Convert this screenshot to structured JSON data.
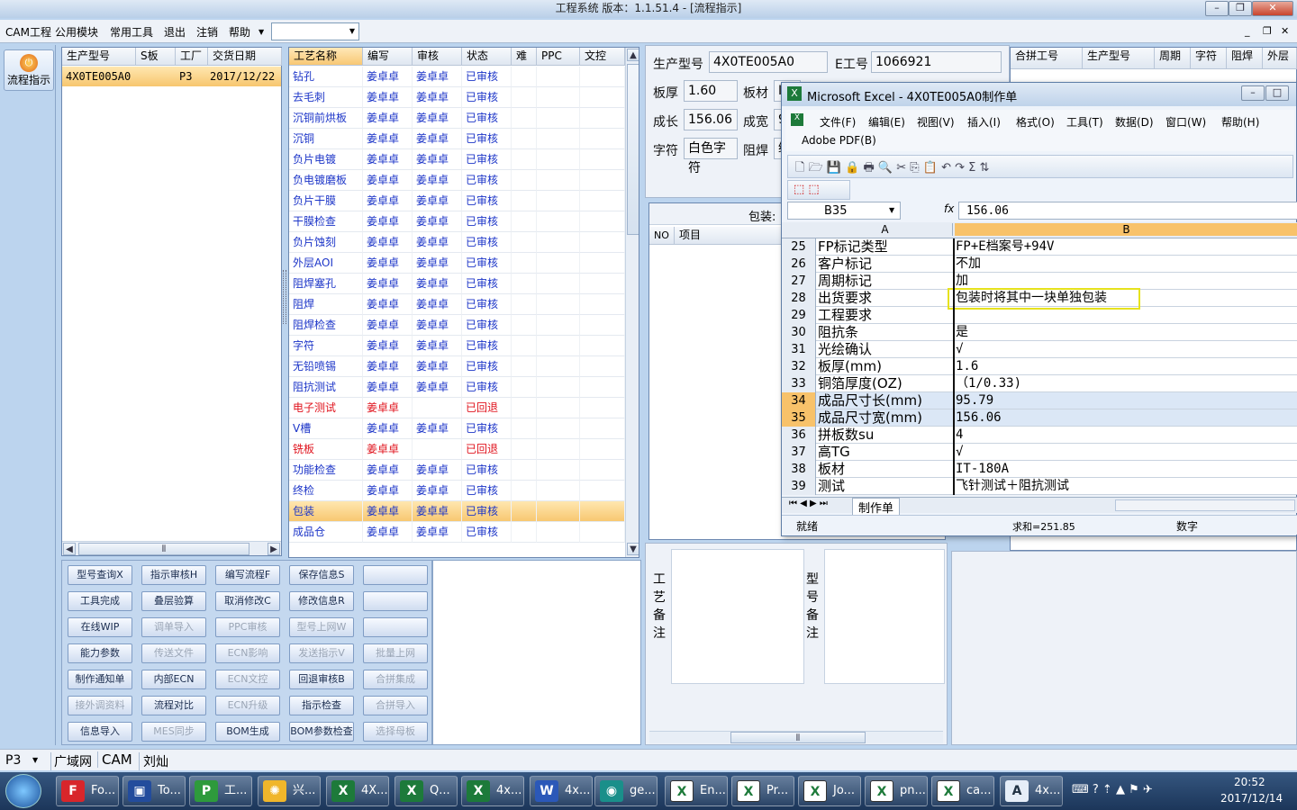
{
  "window": {
    "title": "工程系统   版本：1.1.51.4 - [流程指示]"
  },
  "menu": {
    "items": [
      "CAM工程",
      "公用模块",
      "常用工具",
      "退出",
      "注销",
      "帮助"
    ]
  },
  "sidebar": {
    "flow_label": "流程指示"
  },
  "order_table": {
    "headers": [
      "生产型号",
      "S板",
      "工厂",
      "交货日期"
    ],
    "rows": [
      {
        "model": "4X0TE005A0",
        "s": "",
        "factory": "P3",
        "date": "2017/12/22"
      }
    ]
  },
  "process_table": {
    "headers": [
      "工艺名称",
      "编写",
      "审核",
      "状态",
      "难",
      "PPC",
      "文控"
    ],
    "rows": [
      {
        "name": "钻孔",
        "writer": "姜卓卓",
        "reviewer": "姜卓卓",
        "status": "已审核"
      },
      {
        "name": "去毛刺",
        "writer": "姜卓卓",
        "reviewer": "姜卓卓",
        "status": "已审核"
      },
      {
        "name": "沉铜前烘板",
        "writer": "姜卓卓",
        "reviewer": "姜卓卓",
        "status": "已审核"
      },
      {
        "name": "沉铜",
        "writer": "姜卓卓",
        "reviewer": "姜卓卓",
        "status": "已审核"
      },
      {
        "name": "负片电镀",
        "writer": "姜卓卓",
        "reviewer": "姜卓卓",
        "status": "已审核"
      },
      {
        "name": "负电镀磨板",
        "writer": "姜卓卓",
        "reviewer": "姜卓卓",
        "status": "已审核"
      },
      {
        "name": "负片干膜",
        "writer": "姜卓卓",
        "reviewer": "姜卓卓",
        "status": "已审核"
      },
      {
        "name": "干膜检查",
        "writer": "姜卓卓",
        "reviewer": "姜卓卓",
        "status": "已审核"
      },
      {
        "name": "负片蚀刻",
        "writer": "姜卓卓",
        "reviewer": "姜卓卓",
        "status": "已审核"
      },
      {
        "name": "外层AOI",
        "writer": "姜卓卓",
        "reviewer": "姜卓卓",
        "status": "已审核"
      },
      {
        "name": "阻焊塞孔",
        "writer": "姜卓卓",
        "reviewer": "姜卓卓",
        "status": "已审核"
      },
      {
        "name": "阻焊",
        "writer": "姜卓卓",
        "reviewer": "姜卓卓",
        "status": "已审核"
      },
      {
        "name": "阻焊检查",
        "writer": "姜卓卓",
        "reviewer": "姜卓卓",
        "status": "已审核"
      },
      {
        "name": "字符",
        "writer": "姜卓卓",
        "reviewer": "姜卓卓",
        "status": "已审核"
      },
      {
        "name": "无铅喷锡",
        "writer": "姜卓卓",
        "reviewer": "姜卓卓",
        "status": "已审核"
      },
      {
        "name": "阻抗测试",
        "writer": "姜卓卓",
        "reviewer": "姜卓卓",
        "status": "已审核"
      },
      {
        "name": "电子测试",
        "writer": "姜卓卓",
        "reviewer": "",
        "status": "已回退",
        "red": true
      },
      {
        "name": "V槽",
        "writer": "姜卓卓",
        "reviewer": "姜卓卓",
        "status": "已审核"
      },
      {
        "name": "铣板",
        "writer": "姜卓卓",
        "reviewer": "",
        "status": "已回退",
        "red": true
      },
      {
        "name": "功能检查",
        "writer": "姜卓卓",
        "reviewer": "姜卓卓",
        "status": "已审核"
      },
      {
        "name": "终检",
        "writer": "姜卓卓",
        "reviewer": "姜卓卓",
        "status": "已审核"
      },
      {
        "name": "包装",
        "writer": "姜卓卓",
        "reviewer": "姜卓卓",
        "status": "已审核",
        "selected": true
      },
      {
        "name": "成品仓",
        "writer": "姜卓卓",
        "reviewer": "姜卓卓",
        "status": "已审核"
      }
    ]
  },
  "buttons": [
    [
      {
        "label": "型号查询X",
        "enabled": true
      },
      {
        "label": "指示审核H",
        "enabled": true
      },
      {
        "label": "编写流程F",
        "enabled": true
      },
      {
        "label": "保存信息S",
        "enabled": true
      },
      {
        "label": "",
        "enabled": true
      }
    ],
    [
      {
        "label": "工具完成",
        "enabled": true
      },
      {
        "label": "叠层验算",
        "enabled": true
      },
      {
        "label": "取消修改C",
        "enabled": true
      },
      {
        "label": "修改信息R",
        "enabled": true
      },
      {
        "label": "",
        "enabled": true
      }
    ],
    [
      {
        "label": "在线WIP",
        "enabled": true
      },
      {
        "label": "调单导入",
        "enabled": false
      },
      {
        "label": "PPC审核",
        "enabled": false
      },
      {
        "label": "型号上网W",
        "enabled": false
      },
      {
        "label": "",
        "enabled": true
      }
    ],
    [
      {
        "label": "能力参数",
        "enabled": true
      },
      {
        "label": "传送文件",
        "enabled": false
      },
      {
        "label": "ECN影响",
        "enabled": false
      },
      {
        "label": "发送指示V",
        "enabled": false
      },
      {
        "label": "批量上网",
        "enabled": false
      }
    ],
    [
      {
        "label": "制作通知单",
        "enabled": true
      },
      {
        "label": "内部ECN",
        "enabled": true
      },
      {
        "label": "ECN文控",
        "enabled": false
      },
      {
        "label": "回退审核B",
        "enabled": true
      },
      {
        "label": "合拼集成",
        "enabled": false
      }
    ],
    [
      {
        "label": "接外调资料",
        "enabled": false
      },
      {
        "label": "流程对比",
        "enabled": true
      },
      {
        "label": "ECN升级",
        "enabled": false
      },
      {
        "label": "指示检查",
        "enabled": true
      },
      {
        "label": "合拼导入",
        "enabled": false
      }
    ],
    [
      {
        "label": "信息导入",
        "enabled": true
      },
      {
        "label": "MES同步",
        "enabled": false
      },
      {
        "label": "BOM生成",
        "enabled": true
      },
      {
        "label": "BOM参数检查",
        "enabled": true
      },
      {
        "label": "选择母板",
        "enabled": false
      }
    ]
  ],
  "info": {
    "model_label": "生产型号",
    "model_value": "4X0TE005A0",
    "eno_label": "E工号",
    "eno_value": "1066921",
    "thickness_label": "板厚",
    "thickness_value": "1.60",
    "material_label": "板材",
    "material_value": "I",
    "length_label": "成长",
    "length_value": "156.06",
    "width_label": "成宽",
    "width_value": "9",
    "char_label": "字符",
    "char_value": "白色字符",
    "mask_label": "阻焊",
    "mask_value": "绿"
  },
  "merge_table": {
    "headers": [
      "合拼工号",
      "生产型号",
      "周期",
      "字符",
      "阻焊",
      "外层"
    ]
  },
  "pack": {
    "label": "包装:",
    "no_header": "NO",
    "item_header": "项目"
  },
  "notes": {
    "process_note_label": "工艺备注",
    "model_note_label": "型号备注"
  },
  "excel": {
    "title": "Microsoft Excel - 4X0TE005A0制作单",
    "menu": [
      "文件(F)",
      "编辑(E)",
      "视图(V)",
      "插入(I)",
      "格式(O)",
      "工具(T)",
      "数据(D)",
      "窗口(W)",
      "帮助(H)"
    ],
    "adobe_menu": "Adobe PDF(B)",
    "name_box": "B35",
    "fx": "fx",
    "formula_value": "156.06",
    "col_a": "A",
    "col_b": "B",
    "rows": [
      {
        "n": "25",
        "a": "FP标记类型",
        "b": "FP+E档案号+94V"
      },
      {
        "n": "26",
        "a": "客户标记",
        "b": "不加"
      },
      {
        "n": "27",
        "a": "周期标记",
        "b": "加"
      },
      {
        "n": "28",
        "a": "出货要求",
        "b": "包装时将其中一块单独包装"
      },
      {
        "n": "29",
        "a": "工程要求",
        "b": ""
      },
      {
        "n": "30",
        "a": "阻抗条",
        "b": "是"
      },
      {
        "n": "31",
        "a": "光绘确认",
        "b": "√"
      },
      {
        "n": "32",
        "a": "板厚(mm)",
        "b": "1.6"
      },
      {
        "n": "33",
        "a": "铜箔厚度(OZ)",
        "b": "（1/0.33)"
      },
      {
        "n": "34",
        "a": "成品尺寸长(mm)",
        "b": "95.79"
      },
      {
        "n": "35",
        "a": "成品尺寸宽(mm)",
        "b": "156.06"
      },
      {
        "n": "36",
        "a": "拼板数su",
        "b": "4"
      },
      {
        "n": "37",
        "a": "高TG",
        "b": "√"
      },
      {
        "n": "38",
        "a": "板材",
        "b": "IT-180A"
      },
      {
        "n": "39",
        "a": "测试",
        "b": "飞针测试＋阻抗测试"
      }
    ],
    "sheet_tab": "制作单",
    "status_ready": "就绪",
    "status_sum": "求和=251.85",
    "status_num": "数字"
  },
  "statusbar": {
    "factory": "P3",
    "net": "广域网",
    "module": "CAM",
    "user": "刘灿"
  },
  "taskbar": {
    "items": [
      {
        "label": "Fo...",
        "icon": "red"
      },
      {
        "label": "To...",
        "icon": "disk"
      },
      {
        "label": "工...",
        "icon": "green"
      },
      {
        "label": "兴...",
        "icon": "sun"
      },
      {
        "label": "4X...",
        "icon": "excel"
      },
      {
        "label": "Q...",
        "icon": "excel"
      },
      {
        "label": "4x...",
        "icon": "excel"
      },
      {
        "label": "4x...",
        "icon": "word"
      },
      {
        "label": "ge...",
        "icon": "eye"
      },
      {
        "label": "En...",
        "icon": "x"
      },
      {
        "label": "Pr...",
        "icon": "x"
      },
      {
        "label": "Jo...",
        "icon": "x"
      },
      {
        "label": "pn...",
        "icon": "x"
      },
      {
        "label": "ca...",
        "icon": "x"
      },
      {
        "label": "4x...",
        "icon": "text"
      }
    ],
    "time": "20:52",
    "date": "2017/12/14"
  },
  "colors": {
    "accent": "#f7c66e",
    "link_blue": "#1c35c8",
    "reject_red": "#e0141e"
  }
}
